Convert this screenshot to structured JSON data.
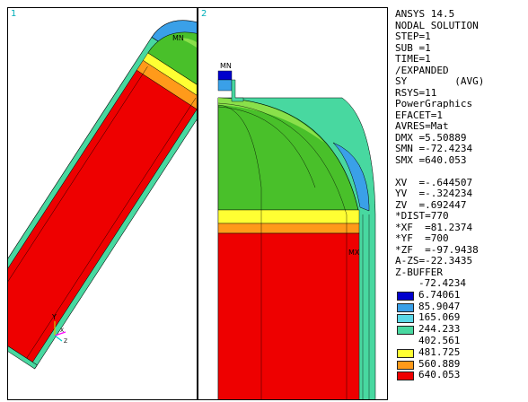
{
  "viewports": [
    {
      "number": "1",
      "marker_label": "MN"
    },
    {
      "number": "2",
      "marker_label": "MN",
      "marker_label_2": "MX"
    }
  ],
  "info": {
    "lines": [
      "ANSYS 14.5",
      "NODAL SOLUTION",
      "STEP=1",
      "SUB =1",
      "TIME=1",
      "/EXPANDED",
      "SY        (AVG)",
      "RSYS=11",
      "PowerGraphics",
      "EFACET=1",
      "AVRES=Mat",
      "DMX =5.50889",
      "SMN =-72.4234",
      "SMX =640.053",
      "",
      "XV  =-.644507",
      "YV  =-.324234",
      "ZV  =.692447",
      "*DIST=770",
      "*XF  =81.2374",
      "*YF  =700",
      "*ZF  =-97.9438",
      "A-ZS=-22.3435",
      "Z-BUFFER"
    ]
  },
  "legend": {
    "top_value": "-72.4234",
    "rows": [
      {
        "color": "#0000cc",
        "value": "6.74061"
      },
      {
        "color": "#3aa0e8",
        "value": "85.9047"
      },
      {
        "color": "#5ad8e8",
        "value": "165.069"
      },
      {
        "color": "#48d8a0",
        "value": "244.233"
      },
      {
        "color": "",
        "value": "402.561"
      },
      {
        "color": "#ffff33",
        "value": "481.725"
      },
      {
        "color": "#ff9a1a",
        "value": "560.889"
      },
      {
        "color": "#ee0000",
        "value": "640.053"
      }
    ]
  },
  "colors": {
    "red": "#ee0000",
    "orange": "#ff9a1a",
    "yellow": "#ffff33",
    "green": "#49c02a",
    "lightgreen": "#8ae04a",
    "cyan": "#5ad8e8",
    "blue": "#3aa0e8",
    "navy": "#0000cc"
  }
}
